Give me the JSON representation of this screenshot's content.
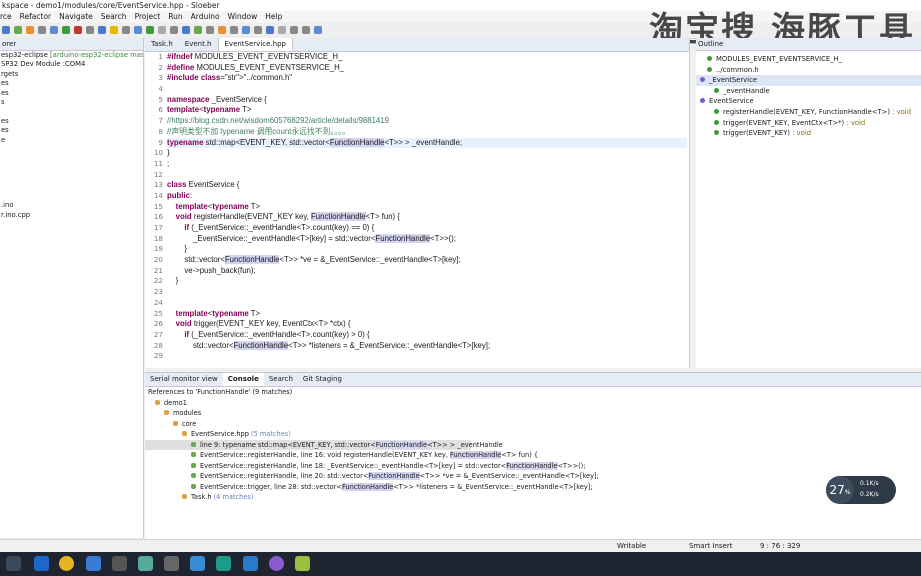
{
  "titlebar": {
    "text": "kspace - demo1/modules/core/EventService.hpp - Sloeber"
  },
  "menu": [
    "rce",
    "Refactor",
    "Navigate",
    "Search",
    "Project",
    "Run",
    "Arduino",
    "Window",
    "Help"
  ],
  "watermark": "淘宝搜 海豚工具",
  "left_panel": {
    "tab": "orer",
    "items": [
      {
        "text": "esp32-eclipse",
        "extra": "[arduino-esp32-eclipse master]"
      },
      {
        "text": "SP32 Dev Module :COM4"
      },
      {
        "text": "rgets"
      },
      {
        "text": "es"
      },
      {
        "text": "es"
      },
      {
        "text": "s"
      },
      {
        "text": ""
      },
      {
        "text": "es"
      },
      {
        "text": "es"
      },
      {
        "text": "e"
      },
      {
        "text": ""
      },
      {
        "text": ""
      },
      {
        "text": ""
      },
      {
        "text": ""
      },
      {
        "text": ""
      },
      {
        "text": ""
      },
      {
        "text": ".ino"
      },
      {
        "text": "r.ino.cpp"
      }
    ]
  },
  "editor": {
    "tabs": [
      {
        "label": "Task.h",
        "active": false
      },
      {
        "label": "Event.h",
        "active": false
      },
      {
        "label": "EventService.hpp",
        "active": true
      }
    ],
    "lines": [
      {
        "n": "1",
        "text": "#ifndef MODULES_EVENT_EVENTSERVICE_H_"
      },
      {
        "n": "2",
        "text": "#define MODULES_EVENT_EVENTSERVICE_H_"
      },
      {
        "n": "3",
        "text": "#include \"../common.h\""
      },
      {
        "n": "4",
        "text": ""
      },
      {
        "n": "5",
        "text": "namespace _EventService {"
      },
      {
        "n": "6",
        "text": "template<typename T>"
      },
      {
        "n": "7",
        "text": "//https://blog.csdn.net/wisdom605768292/article/details/9881419"
      },
      {
        "n": "8",
        "text": "//声明类型不加 typename 调用count永远找不到。。。。"
      },
      {
        "n": "9",
        "text": "typename std::map<EVENT_KEY, std::vector<FunctionHandle<T>> > _eventHandle;"
      },
      {
        "n": "10",
        "text": "}"
      },
      {
        "n": "11",
        "text": ";"
      },
      {
        "n": "12",
        "text": ""
      },
      {
        "n": "13",
        "text": "class EventService {"
      },
      {
        "n": "14",
        "text": "public:"
      },
      {
        "n": "15",
        "text": "    template<typename T>"
      },
      {
        "n": "16",
        "text": "    void registerHandle(EVENT_KEY key, FunctionHandle<T> fun) {"
      },
      {
        "n": "17",
        "text": "        if (_EventService::_eventHandle<T>.count(key) == 0) {"
      },
      {
        "n": "18",
        "text": "            _EventService::_eventHandle<T>[key] = std::vector<FunctionHandle<T>>();"
      },
      {
        "n": "19",
        "text": "        }"
      },
      {
        "n": "20",
        "text": "        std::vector<FunctionHandle<T>> *ve = &_EventService::_eventHandle<T>[key];"
      },
      {
        "n": "21",
        "text": "        ve->push_back(fun);"
      },
      {
        "n": "22",
        "text": "    }"
      },
      {
        "n": "23",
        "text": ""
      },
      {
        "n": "24",
        "text": ""
      },
      {
        "n": "25",
        "text": "    template<typename T>"
      },
      {
        "n": "26",
        "text": "    void trigger(EVENT_KEY key, EventCtx<T> *ctx) {"
      },
      {
        "n": "27",
        "text": "        if (_EventService::_eventHandle<T>.count(key) > 0) {"
      },
      {
        "n": "28",
        "text": "            std::vector<FunctionHandle<T>> *listeners = &_EventService::_eventHandle<T>[key];"
      },
      {
        "n": "29",
        "text": ""
      }
    ]
  },
  "outline": {
    "tab": "Outline",
    "items": [
      {
        "text": "MODULES_EVENT_EVENTSERVICE_H_",
        "sig": "",
        "indent": 1
      },
      {
        "text": "../common.h",
        "sig": "",
        "indent": 1
      },
      {
        "text": "_EventService",
        "sig": "",
        "indent": 0
      },
      {
        "text": "_eventHandle",
        "sig": "",
        "indent": 2
      },
      {
        "text": "EventService",
        "sig": "",
        "indent": 0
      },
      {
        "text": "registerHandle(EVENT_KEY, FunctionHandle<T>)",
        "sig": " : void",
        "indent": 2
      },
      {
        "text": "trigger(EVENT_KEY, EventCtx<T>*)",
        "sig": " : void",
        "indent": 2
      },
      {
        "text": "trigger(EVENT_KEY)",
        "sig": " : void",
        "indent": 2
      }
    ]
  },
  "bottom": {
    "tabs": [
      {
        "label": "Serial monitor view",
        "active": false
      },
      {
        "label": "Console",
        "active": true
      },
      {
        "label": "Search",
        "active": false
      },
      {
        "label": "Git Staging",
        "active": false
      }
    ],
    "header": "References to 'FunctionHandle' (9 matches)",
    "tree": [
      {
        "text": "demo1",
        "indent": 0,
        "style": ""
      },
      {
        "text": "modules",
        "indent": 1,
        "style": ""
      },
      {
        "text": "core",
        "indent": 2,
        "style": ""
      },
      {
        "text": "EventService.hpp",
        "extra": " (5 matches)",
        "indent": 3,
        "style": ""
      },
      {
        "text": "line 9: typename std::map<EVENT_KEY, std::vector<FunctionHandle<T>> > _eventHandle",
        "indent": 4,
        "style": "sel"
      },
      {
        "text": "EventService::registerHandle, line 16: void registerHandle(EVENT_KEY key, FunctionHandle<T> fun) {",
        "indent": 4,
        "style": ""
      },
      {
        "text": "EventService::registerHandle, line 18: _EventService::_eventHandle<T>[key] = std::vector<FunctionHandle<T>>();",
        "indent": 4,
        "style": ""
      },
      {
        "text": "EventService::registerHandle, line 20: std::vector<FunctionHandle<T>> *ve = &_EventService::_eventHandle<T>[key];",
        "indent": 4,
        "style": ""
      },
      {
        "text": "EventService::trigger, line 28: std::vector<FunctionHandle<T>> *listeners = &_EventService::_eventHandle<T>[key];",
        "indent": 4,
        "style": ""
      },
      {
        "text": "Task.h",
        "extra": " (4 matches)",
        "indent": 3,
        "style": ""
      }
    ]
  },
  "status": {
    "writable": "Writable",
    "insert": "Smart Insert",
    "position": "9 : 76 : 329"
  },
  "gauge": {
    "value": "27",
    "unit": "%",
    "up": "0.1K/s",
    "down": "0.2K/s"
  }
}
